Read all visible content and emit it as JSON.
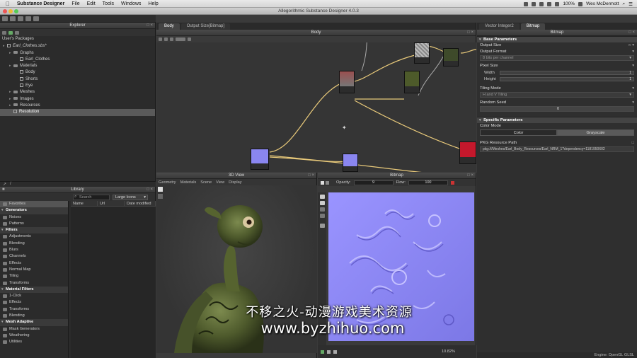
{
  "menubar": {
    "app_name": "Substance Designer",
    "items": [
      "File",
      "Edit",
      "Tools",
      "Windows",
      "Help"
    ],
    "battery": "100%",
    "clock": "Wes McDermott"
  },
  "window": {
    "title": "Allegorithmic Substance Designer 4.0.3"
  },
  "explorer": {
    "title": "Explorer",
    "section": "User's Packages",
    "items": [
      {
        "label": "Earl_Clothes.sbs*",
        "depth": 0,
        "kind": "package"
      },
      {
        "label": "Graphs",
        "depth": 1,
        "kind": "folder"
      },
      {
        "label": "Earl_Clothes",
        "depth": 2,
        "kind": "graph"
      },
      {
        "label": "Materials",
        "depth": 1,
        "kind": "folder"
      },
      {
        "label": "Body",
        "depth": 2,
        "kind": "res"
      },
      {
        "label": "Shorts",
        "depth": 2,
        "kind": "res"
      },
      {
        "label": "Eye",
        "depth": 2,
        "kind": "res"
      },
      {
        "label": "Meshes",
        "depth": 1,
        "kind": "folder"
      },
      {
        "label": "Images",
        "depth": 1,
        "kind": "folder"
      },
      {
        "label": "Resources",
        "depth": 1,
        "kind": "folder"
      },
      {
        "label": "Resolution",
        "depth": 1,
        "kind": "res",
        "selected": true
      }
    ]
  },
  "library": {
    "title": "Library",
    "search_placeholder": "Search",
    "view_mode": "Large Icons",
    "columns": [
      "Name",
      "Url",
      "Date modified"
    ],
    "categories": [
      {
        "label": "Favorites",
        "type": "fav"
      },
      {
        "label": "Generators",
        "type": "section"
      },
      {
        "label": "Noises",
        "type": "item"
      },
      {
        "label": "Patterns",
        "type": "item"
      },
      {
        "label": "Filters",
        "type": "section"
      },
      {
        "label": "Adjustments",
        "type": "item"
      },
      {
        "label": "Blending",
        "type": "item"
      },
      {
        "label": "Blurs",
        "type": "item"
      },
      {
        "label": "Channels",
        "type": "item"
      },
      {
        "label": "Effects",
        "type": "item"
      },
      {
        "label": "Normal Map",
        "type": "item"
      },
      {
        "label": "Tiling",
        "type": "item"
      },
      {
        "label": "Transforms",
        "type": "item"
      },
      {
        "label": "Material Filters",
        "type": "section"
      },
      {
        "label": "1-Click",
        "type": "item"
      },
      {
        "label": "Effects",
        "type": "item"
      },
      {
        "label": "Transforms",
        "type": "item"
      },
      {
        "label": "Blending",
        "type": "item"
      },
      {
        "label": "Mesh Adaptive",
        "type": "section"
      },
      {
        "label": "Mask Generators",
        "type": "item"
      },
      {
        "label": "Weathering",
        "type": "item"
      },
      {
        "label": "Utilities",
        "type": "item"
      }
    ]
  },
  "graph": {
    "panel_title": "Body",
    "tabs": [
      "Body",
      "Output Size[Bitmap]"
    ]
  },
  "view3d": {
    "panel_title": "3D View",
    "menu": [
      "Geometry",
      "Materials",
      "Scene",
      "View",
      "Display"
    ]
  },
  "bitmap": {
    "panel_title": "Bitmap",
    "opacity_label": "Opacity:",
    "opacity_value": "9",
    "flow_label": "Flow:",
    "flow_value": "100",
    "zoom": "10.82%"
  },
  "properties": {
    "tabs": [
      "Vector Integer2",
      "Bitmap"
    ],
    "panel_title": "Bitmap",
    "base_section": "Base Parameters",
    "output_size_label": "Output Size",
    "output_format_label": "Output Format",
    "output_format_value": "8 bits per channel",
    "pixel_size_label": "Pixel Size",
    "width_label": "Width",
    "width_value": "1",
    "height_label": "Height",
    "height_value": "1",
    "tiling_mode_label": "Tiling Mode",
    "tiling_mode_value": "H and V Tiling",
    "random_seed_label": "Random Seed",
    "random_seed_value": "0",
    "specific_section": "Specific Parameters",
    "color_mode_label": "Color Mode",
    "color_option": "Color",
    "grayscale_option": "Grayscale",
    "pkg_path_label": "PKG Resource Path",
    "pkg_path_value": "pkg:///Meshes/Earl_Body_Resources/Earl_NRM_1?dependency=1181950602"
  },
  "statusbar": {
    "engine": "Engine: OpenGL GLSL"
  },
  "watermark": {
    "cn": "不移之火-动漫游戏美术资源",
    "url": "www.byzhihuo.com"
  },
  "colors": {
    "accent_wire": "#e8c97a",
    "normal_map": "#8a86f0",
    "node_red": "#c4182c"
  }
}
